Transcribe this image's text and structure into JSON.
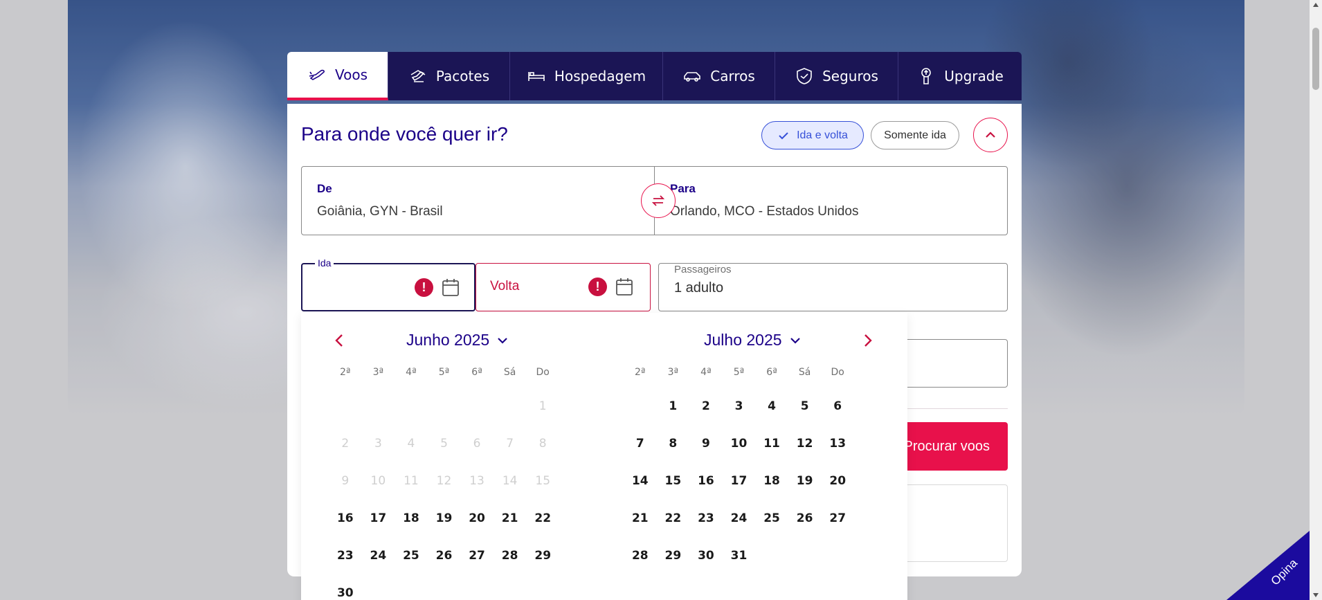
{
  "tabs": [
    {
      "label": "Voos",
      "icon": "plane-icon",
      "active": true
    },
    {
      "label": "Pacotes",
      "icon": "package-icon",
      "active": false
    },
    {
      "label": "Hospedagem",
      "icon": "bed-icon",
      "active": false
    },
    {
      "label": "Carros",
      "icon": "car-icon",
      "active": false
    },
    {
      "label": "Seguros",
      "icon": "shield-icon",
      "active": false
    },
    {
      "label": "Upgrade",
      "icon": "upgrade-icon",
      "active": false
    }
  ],
  "search": {
    "title": "Para onde você quer ir?",
    "trip_roundtrip": "Ida e volta",
    "trip_oneway": "Somente ida",
    "from_label": "De",
    "from_value": "Goiânia, GYN - Brasil",
    "to_label": "Para",
    "to_value": "Orlando, MCO - Estados Unidos",
    "ida_label": "Ida",
    "ida_value": "",
    "volta_placeholder": "Volta",
    "passengers_label": "Passageiros",
    "passengers_value": "1 adulto",
    "search_button": "Procurar voos"
  },
  "calendar": {
    "weekdays": [
      "2ª",
      "3ª",
      "4ª",
      "5ª",
      "6ª",
      "Sá",
      "Do"
    ],
    "months": [
      {
        "title": "Junho 2025",
        "weeks": [
          [
            {
              "d": "",
              "s": "empty"
            },
            {
              "d": "",
              "s": "empty"
            },
            {
              "d": "",
              "s": "empty"
            },
            {
              "d": "",
              "s": "empty"
            },
            {
              "d": "",
              "s": "empty"
            },
            {
              "d": "",
              "s": "empty"
            },
            {
              "d": "1",
              "s": "disabled"
            }
          ],
          [
            {
              "d": "2",
              "s": "disabled"
            },
            {
              "d": "3",
              "s": "disabled"
            },
            {
              "d": "4",
              "s": "disabled"
            },
            {
              "d": "5",
              "s": "disabled"
            },
            {
              "d": "6",
              "s": "disabled"
            },
            {
              "d": "7",
              "s": "disabled"
            },
            {
              "d": "8",
              "s": "disabled"
            }
          ],
          [
            {
              "d": "9",
              "s": "disabled"
            },
            {
              "d": "10",
              "s": "disabled"
            },
            {
              "d": "11",
              "s": "disabled"
            },
            {
              "d": "12",
              "s": "disabled"
            },
            {
              "d": "13",
              "s": "disabled"
            },
            {
              "d": "14",
              "s": "disabled"
            },
            {
              "d": "15",
              "s": "disabled"
            }
          ],
          [
            {
              "d": "16",
              "s": ""
            },
            {
              "d": "17",
              "s": ""
            },
            {
              "d": "18",
              "s": ""
            },
            {
              "d": "19",
              "s": ""
            },
            {
              "d": "20",
              "s": ""
            },
            {
              "d": "21",
              "s": ""
            },
            {
              "d": "22",
              "s": ""
            }
          ],
          [
            {
              "d": "23",
              "s": ""
            },
            {
              "d": "24",
              "s": ""
            },
            {
              "d": "25",
              "s": ""
            },
            {
              "d": "26",
              "s": ""
            },
            {
              "d": "27",
              "s": ""
            },
            {
              "d": "28",
              "s": ""
            },
            {
              "d": "29",
              "s": ""
            }
          ],
          [
            {
              "d": "30",
              "s": ""
            },
            {
              "d": "",
              "s": "empty"
            },
            {
              "d": "",
              "s": "empty"
            },
            {
              "d": "",
              "s": "empty"
            },
            {
              "d": "",
              "s": "empty"
            },
            {
              "d": "",
              "s": "empty"
            },
            {
              "d": "",
              "s": "empty"
            }
          ]
        ]
      },
      {
        "title": "Julho 2025",
        "weeks": [
          [
            {
              "d": "",
              "s": "empty"
            },
            {
              "d": "1",
              "s": ""
            },
            {
              "d": "2",
              "s": ""
            },
            {
              "d": "3",
              "s": ""
            },
            {
              "d": "4",
              "s": ""
            },
            {
              "d": "5",
              "s": ""
            },
            {
              "d": "6",
              "s": ""
            }
          ],
          [
            {
              "d": "7",
              "s": ""
            },
            {
              "d": "8",
              "s": ""
            },
            {
              "d": "9",
              "s": ""
            },
            {
              "d": "10",
              "s": ""
            },
            {
              "d": "11",
              "s": ""
            },
            {
              "d": "12",
              "s": ""
            },
            {
              "d": "13",
              "s": ""
            }
          ],
          [
            {
              "d": "14",
              "s": ""
            },
            {
              "d": "15",
              "s": ""
            },
            {
              "d": "16",
              "s": ""
            },
            {
              "d": "17",
              "s": ""
            },
            {
              "d": "18",
              "s": ""
            },
            {
              "d": "19",
              "s": ""
            },
            {
              "d": "20",
              "s": ""
            }
          ],
          [
            {
              "d": "21",
              "s": ""
            },
            {
              "d": "22",
              "s": ""
            },
            {
              "d": "23",
              "s": ""
            },
            {
              "d": "24",
              "s": ""
            },
            {
              "d": "25",
              "s": ""
            },
            {
              "d": "26",
              "s": ""
            },
            {
              "d": "27",
              "s": ""
            }
          ],
          [
            {
              "d": "28",
              "s": ""
            },
            {
              "d": "29",
              "s": ""
            },
            {
              "d": "30",
              "s": ""
            },
            {
              "d": "31",
              "s": ""
            },
            {
              "d": "",
              "s": "empty"
            },
            {
              "d": "",
              "s": "empty"
            },
            {
              "d": "",
              "s": "empty"
            }
          ]
        ]
      }
    ]
  },
  "feedback": {
    "label": "Opina"
  },
  "colors": {
    "brand_navy": "#1b0088",
    "accent_red": "#e8114b",
    "error_red": "#c8103f",
    "selected_blue": "#3650d8"
  }
}
